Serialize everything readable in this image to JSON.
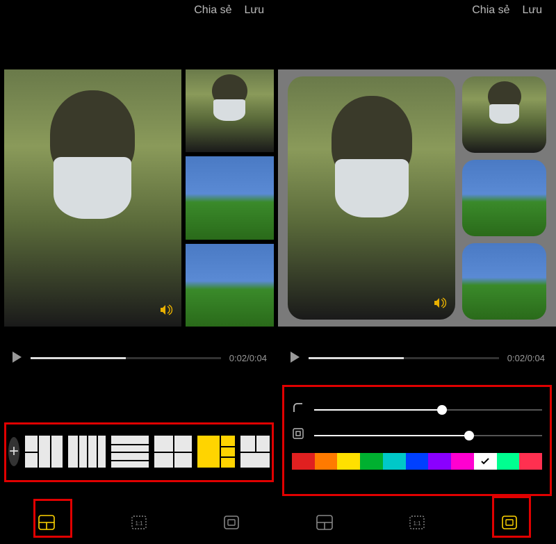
{
  "header": {
    "share_label": "Chia sẻ",
    "save_label": "Lưu"
  },
  "playback": {
    "time_text": "0:02/0:04",
    "progress_pct": 50
  },
  "left_screen": {
    "active_bottom_tab": 0
  },
  "right_screen": {
    "active_bottom_tab": 2,
    "slider_corner_pct": 56,
    "slider_margin_pct": 68,
    "swatches": [
      "#e02020",
      "#ff7a00",
      "#ffe000",
      "#00b030",
      "#00c8c8",
      "#0040ff",
      "#8a00ff",
      "#ff00d0",
      "#ffffff",
      "#00ff90",
      "#ff3050"
    ],
    "selected_swatch_index": 8
  }
}
